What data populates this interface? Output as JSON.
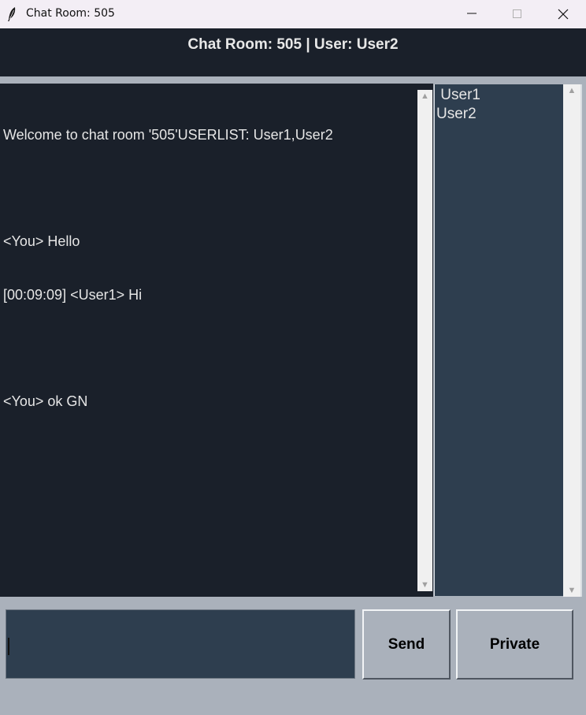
{
  "window": {
    "title": "Chat Room: 505",
    "icon": "feather-icon"
  },
  "header": {
    "text": "Chat Room: 505 | User: User2"
  },
  "chat": {
    "lines": [
      "Welcome to chat room '505'USERLIST: User1,User2",
      "",
      "<You> Hello",
      "[00:09:09] <User1> Hi",
      "",
      "<You> ok GN"
    ]
  },
  "users": {
    "items": [
      " User1",
      "User2"
    ]
  },
  "input": {
    "value": ""
  },
  "buttons": {
    "send_label": "Send",
    "private_label": "Private"
  },
  "colors": {
    "header_bg": "#1a202a",
    "chat_bg": "#1a202a",
    "panel_bg": "#2e3e4f",
    "body_bg": "#aab1bb",
    "text": "#e6e6e6"
  }
}
